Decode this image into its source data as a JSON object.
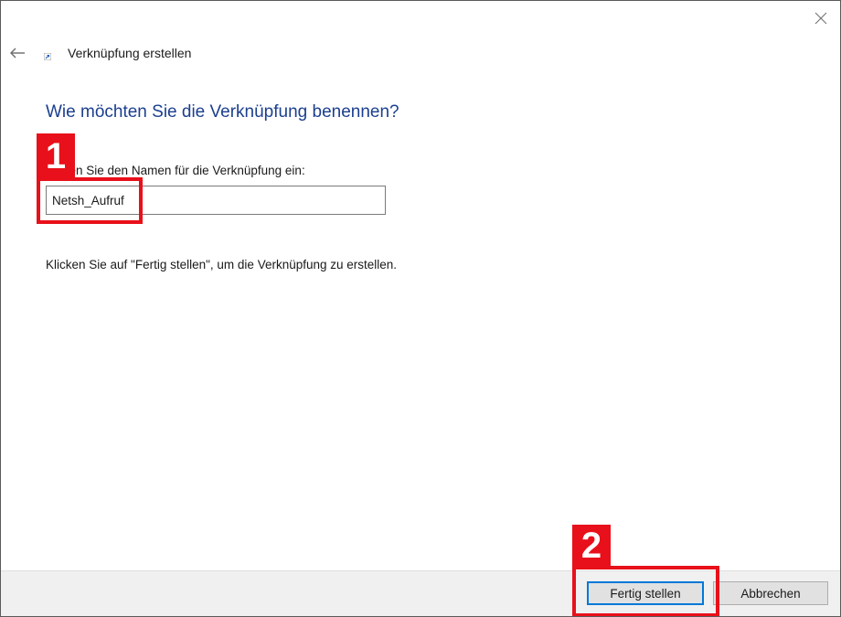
{
  "wizard": {
    "title": "Verknüpfung erstellen",
    "heading": "Wie möchten Sie die Verknüpfung benennen?",
    "field_label": "Geben Sie den Namen für die Verknüpfung ein:",
    "name_value": "Netsh_Aufruf",
    "hint": "Klicken Sie auf \"Fertig stellen\", um die Verknüpfung zu erstellen."
  },
  "buttons": {
    "finish_label": "Fertig stellen",
    "cancel_label": "Abbrechen"
  },
  "annotations": {
    "marker_1": "1",
    "marker_2": "2"
  },
  "icons": {
    "back": "arrow-left-icon",
    "close": "close-icon",
    "shortcut": "shortcut-icon"
  },
  "colors": {
    "heading": "#1b3f8f",
    "focus_border": "#0078d7",
    "marker": "#e8101a",
    "footer_bg": "#f0f0f0"
  }
}
